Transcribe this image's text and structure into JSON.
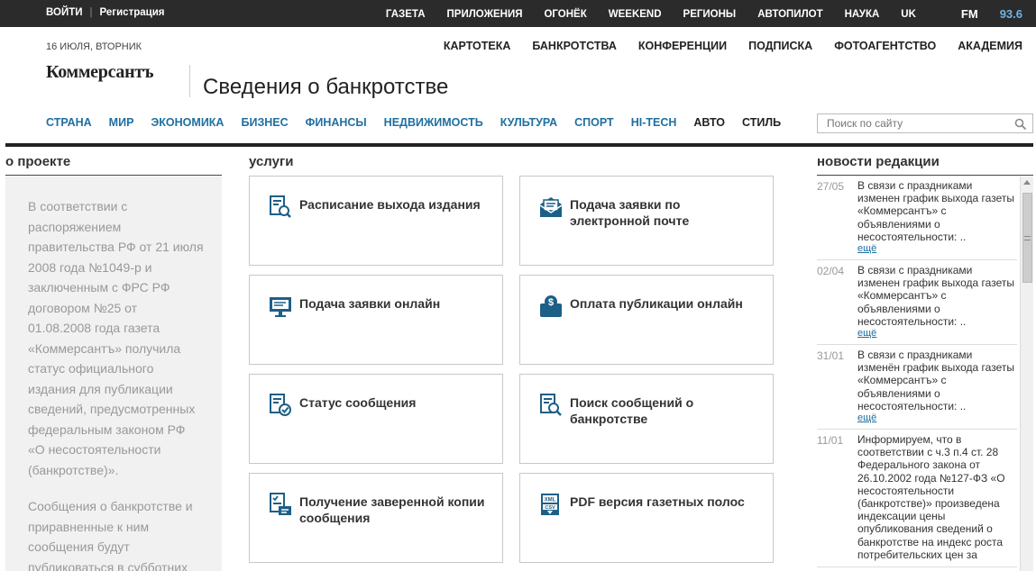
{
  "topbar": {
    "login": "ВОЙТИ",
    "register": "Регистрация",
    "nav": [
      "ГАЗЕТА",
      "ПРИЛОЖЕНИЯ",
      "ОГОНЁК",
      "WEEKEND",
      "РЕГИОНЫ",
      "АВТОПИЛОТ",
      "НАУКА",
      "UK"
    ],
    "fm_prefix": "FM",
    "fm_freq": "93.6"
  },
  "header": {
    "date": "16 ИЮЛЯ, ВТОРНИК",
    "logo": "Коммерсантъ",
    "title": "Сведения о банкротстве",
    "secnav": [
      "КАРТОТЕКА",
      "БАНКРОТСТВА",
      "КОНФЕРЕНЦИИ",
      "ПОДПИСКА",
      "ФОТОАГЕНТСТВО",
      "АКАДЕМИЯ"
    ],
    "catnav": [
      "СТРАНА",
      "МИР",
      "ЭКОНОМИКА",
      "БИЗНЕС",
      "ФИНАНСЫ",
      "НЕДВИЖИМОСТЬ",
      "КУЛЬТУРА",
      "СПОРТ",
      "HI-TECH",
      "АВТО",
      "СТИЛЬ"
    ],
    "search_placeholder": "Поиск по сайту"
  },
  "about": {
    "heading": "о проекте",
    "p1": "В соответствии с распоряжением правительства РФ от 21 июля 2008 года №1049-р и заключенным с ФРС РФ договором №25 от 01.08.2008 года газета «Коммерсантъ» получила статус официального издания для публикации сведений, предусмотренных федеральным законом РФ «О несостоятельности (банкротстве)».",
    "p2": "Сообщения о банкротстве и приравненные к ним сообщения будут публиковаться в субботних"
  },
  "services": {
    "heading": "услуги",
    "items": [
      {
        "label": "Расписание выхода издания",
        "icon": "schedule-icon"
      },
      {
        "label": "Подача заявки по электронной почте",
        "icon": "email-application-icon"
      },
      {
        "label": "Подача заявки онлайн",
        "icon": "online-application-icon"
      },
      {
        "label": "Оплата публикации онлайн",
        "icon": "payment-icon"
      },
      {
        "label": "Статус сообщения",
        "icon": "message-status-icon"
      },
      {
        "label": "Поиск сообщений о банкротстве",
        "icon": "search-messages-icon"
      },
      {
        "label": "Получение заверенной копии сообщения",
        "icon": "certified-copy-icon"
      },
      {
        "label": "PDF версия газетных полос",
        "icon": "pdf-version-icon"
      }
    ]
  },
  "news": {
    "heading": "новости редакции",
    "more_label": "ещё",
    "items": [
      {
        "date": "27/05",
        "text": "В связи с праздниками изменен график выхода газеты «Коммерсантъ» с объявлениями о несостоятельности: ..",
        "more": "ещё"
      },
      {
        "date": "02/04",
        "text": "В связи с праздниками изменен график выхода газеты «Коммерсантъ» с объявлениями о несостоятельности: ..",
        "more": "ещё"
      },
      {
        "date": "31/01",
        "text": "В связи с праздниками изменён график выхода газеты «Коммерсантъ» с объявлениями о несостоятельности: ..",
        "more": "ещё"
      },
      {
        "date": "11/01",
        "text": "Информируем, что в соответствии с ч.3 п.4 ст. 28 Федерального закона от 26.10.2002 года №127-ФЗ «О несостоятельности (банкротстве)» произведена индексации цены опубликования сведений о банкротстве на индекс роста потребительских цен за",
        "more": ""
      }
    ]
  },
  "colors": {
    "topbar_bg": "#2b2b2b",
    "link_blue": "#1f6fa0",
    "icon_blue": "#1d5f86",
    "about_bg": "#f1f1f1"
  }
}
